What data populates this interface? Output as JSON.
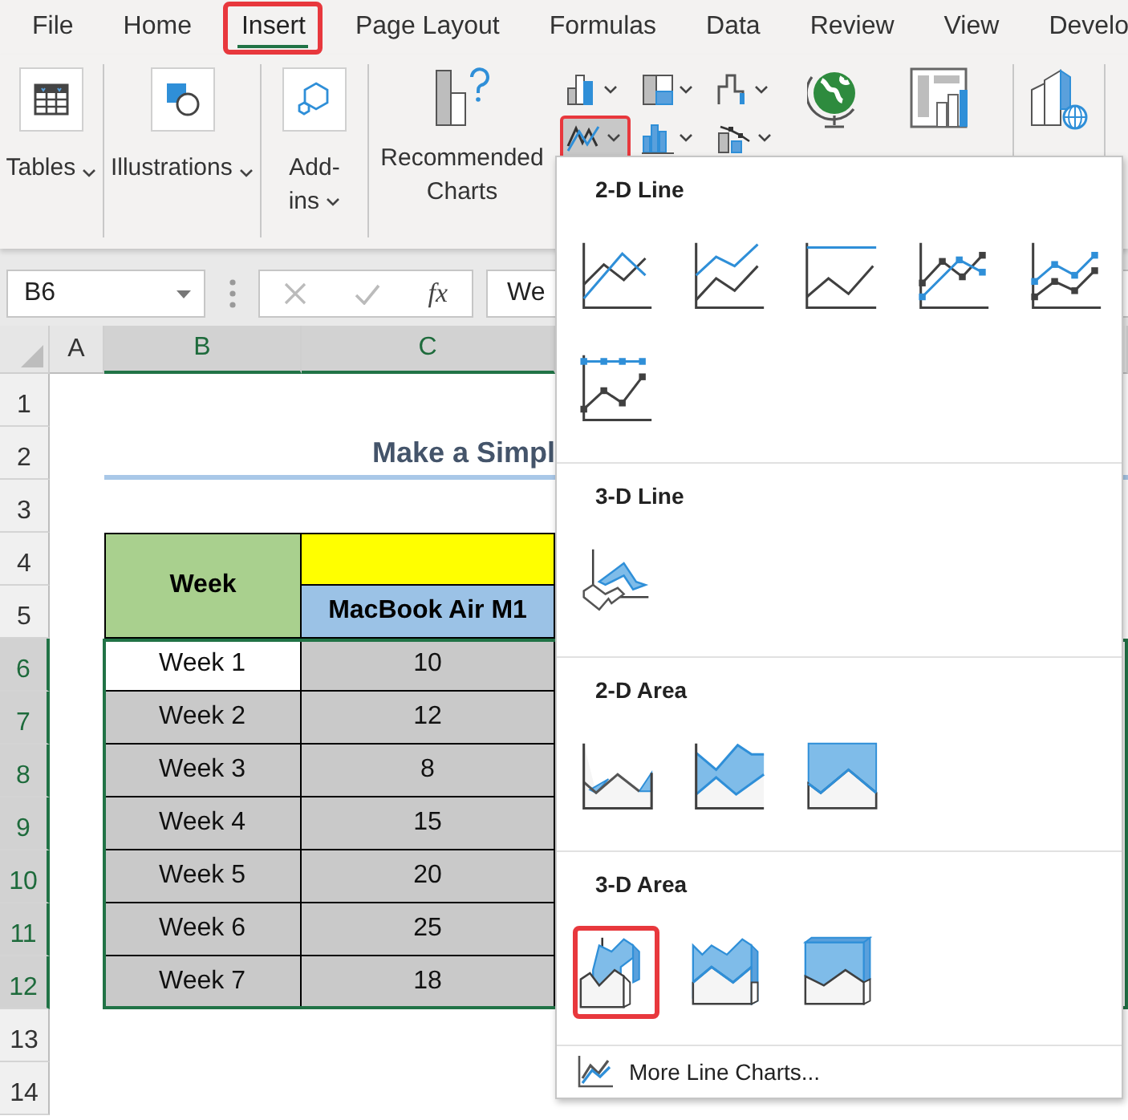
{
  "tabs": [
    {
      "label": "File",
      "selected": false,
      "highlighted": false
    },
    {
      "label": "Home",
      "selected": false,
      "highlighted": false
    },
    {
      "label": "Insert",
      "selected": true,
      "highlighted": true
    },
    {
      "label": "Page Layout",
      "selected": false,
      "highlighted": false
    },
    {
      "label": "Formulas",
      "selected": false,
      "highlighted": false
    },
    {
      "label": "Data",
      "selected": false,
      "highlighted": false
    },
    {
      "label": "Review",
      "selected": false,
      "highlighted": false
    },
    {
      "label": "View",
      "selected": false,
      "highlighted": false
    },
    {
      "label": "Develo",
      "selected": false,
      "highlighted": false
    }
  ],
  "ribbon": {
    "groups": [
      {
        "kind": "tables",
        "label": "Tables",
        "dropdown": true
      },
      {
        "kind": "illustrations",
        "label": "Illustrations",
        "dropdown": true
      },
      {
        "kind": "addins",
        "label": "Add-ins",
        "dropdown": true
      },
      {
        "kind": "recommended",
        "label": "Recommended Charts",
        "dropdown": false
      }
    ],
    "chart_buttons": [
      {
        "kind": "column",
        "highlighted": false
      },
      {
        "kind": "hierarchy",
        "highlighted": false
      },
      {
        "kind": "waterfall",
        "highlighted": false
      },
      {
        "kind": "line",
        "highlighted": true
      },
      {
        "kind": "statistic",
        "highlighted": false
      },
      {
        "kind": "combo",
        "highlighted": false
      }
    ],
    "tail_groups": [
      {
        "kind": "maps"
      },
      {
        "kind": "pivotchart"
      },
      {
        "kind": "map3d"
      }
    ]
  },
  "formula_bar": {
    "name_box": "B6",
    "function_label": "fx",
    "value": "We"
  },
  "sheet": {
    "columns": [
      {
        "label": "A",
        "selected": false
      },
      {
        "label": "B",
        "selected": true
      },
      {
        "label": "C",
        "selected": true
      }
    ],
    "rows": [
      {
        "label": "1",
        "selected": false
      },
      {
        "label": "2",
        "selected": false
      },
      {
        "label": "3",
        "selected": false
      },
      {
        "label": "4",
        "selected": false
      },
      {
        "label": "5",
        "selected": false
      },
      {
        "label": "6",
        "selected": true
      },
      {
        "label": "7",
        "selected": true
      },
      {
        "label": "8",
        "selected": true
      },
      {
        "label": "9",
        "selected": true
      },
      {
        "label": "10",
        "selected": true
      },
      {
        "label": "11",
        "selected": true
      },
      {
        "label": "12",
        "selected": true
      },
      {
        "label": "13",
        "selected": false
      },
      {
        "label": "14",
        "selected": false
      }
    ],
    "title": "Make a Simpl",
    "table": {
      "header": "Week",
      "series_header": "MacBook Air M1",
      "rows": [
        {
          "week": "Week 1",
          "value": "10",
          "active": true
        },
        {
          "week": "Week 2",
          "value": "12",
          "active": false
        },
        {
          "week": "Week 3",
          "value": "8",
          "active": false
        },
        {
          "week": "Week 4",
          "value": "15",
          "active": false
        },
        {
          "week": "Week 5",
          "value": "20",
          "active": false
        },
        {
          "week": "Week 6",
          "value": "25",
          "active": false
        },
        {
          "week": "Week 7",
          "value": "18",
          "active": false
        }
      ]
    }
  },
  "chart_menu": {
    "sections": [
      {
        "title": "2-D Line",
        "items": [
          {
            "kind": "line",
            "highlighted": false
          },
          {
            "kind": "line-stacked",
            "highlighted": false
          },
          {
            "kind": "line-100",
            "highlighted": false
          },
          {
            "kind": "line-markers",
            "highlighted": false
          },
          {
            "kind": "line-stacked-markers",
            "highlighted": false
          },
          {
            "kind": "line-100-markers",
            "highlighted": false
          }
        ]
      },
      {
        "title": "3-D Line",
        "items": [
          {
            "kind": "line-3d",
            "highlighted": false
          }
        ]
      },
      {
        "title": "2-D Area",
        "items": [
          {
            "kind": "area",
            "highlighted": false
          },
          {
            "kind": "area-stacked",
            "highlighted": false
          },
          {
            "kind": "area-100",
            "highlighted": false
          }
        ]
      },
      {
        "title": "3-D Area",
        "items": [
          {
            "kind": "area-3d",
            "highlighted": true
          },
          {
            "kind": "area-3d-stacked",
            "highlighted": false
          },
          {
            "kind": "area-3d-100",
            "highlighted": false
          }
        ]
      }
    ],
    "footer": "More Line Charts..."
  }
}
